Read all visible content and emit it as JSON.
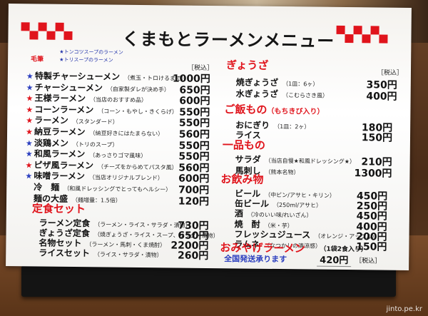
{
  "menu": {
    "title": "くまもとラーメンメニュー",
    "legend": [
      "★トンコツスープのラーメン",
      "★トリスープのラーメン"
    ],
    "stamp": "毛筆",
    "tax_label": "［税込］",
    "ramen": [
      {
        "mark": "blue",
        "name": "特製チャーシューメン",
        "note": "（煮玉・トロけるまで）",
        "price": "1000円"
      },
      {
        "mark": "blue",
        "name": "チャーシューメン",
        "note": "（自家製ダレが決め手）",
        "price": "650円"
      },
      {
        "mark": "red",
        "name": "王様ラーメン",
        "note": "（当店のおすすめ品）",
        "price": "600円"
      },
      {
        "mark": "red",
        "name": "コーンラーメン",
        "note": "（コーン・もやし・きくらげ）",
        "price": "550円"
      },
      {
        "mark": "red",
        "name": "ラーメン",
        "note": "（スタンダード）",
        "price": "550円"
      },
      {
        "mark": "red",
        "name": "納豆ラーメン",
        "note": "（納豆好きにはたまらない）",
        "price": "560円"
      },
      {
        "mark": "blue",
        "name": "淡鶏メン",
        "note": "（トリのスープ）",
        "price": "550円"
      },
      {
        "mark": "blue",
        "name": "和風ラーメン",
        "note": "（あっさりゴマ風味）",
        "price": "550円"
      },
      {
        "mark": "red",
        "name": "ピザ風ラーメン",
        "note": "（チーズをからめてパスタ風）",
        "price": "560円"
      },
      {
        "mark": "blue",
        "name": "味噌ラーメン",
        "note": "（当店オリジナルブレンド）",
        "price": "600円"
      },
      {
        "mark": "",
        "name": "冷　麺",
        "note": "（和風ドレッシングでとってもヘルシー）",
        "price": "700円"
      },
      {
        "mark": "",
        "name": "麺の大盛",
        "note": "（麺増量：1.5倍）",
        "price": "120円"
      }
    ],
    "teishoku_title": "定食セット",
    "teishoku": [
      {
        "name": "ラーメン定食",
        "note": "（ラーメン・ライス・サラダ・漬物）",
        "price": "730円"
      },
      {
        "name": "ぎょうざ定食",
        "note": "（焼ぎょうざ・ライス・スープ、サラダ・漬物）",
        "price": "650円"
      },
      {
        "name": "名物セット",
        "note": "（ラーメン・馬刺・くま焼酎）",
        "price": "2200円"
      },
      {
        "name": "ライスセット",
        "note": "（ライス・サラダ・漬物）",
        "price": "260円"
      }
    ],
    "gyoza_title": "ぎょうざ",
    "gyoza": [
      {
        "name": "焼ぎょうざ",
        "note": "（1皿：6ヶ）",
        "price": "350円"
      },
      {
        "name": "水ぎょうざ",
        "note": "（こむらさき風）",
        "price": "400円"
      }
    ],
    "gohan_title": "ご飯もの",
    "gohan_sub": "（もちきび入り）",
    "gohan": [
      {
        "name": "おにぎり",
        "note": "（1皿：2ヶ）",
        "price": "180円"
      },
      {
        "name": "ライス",
        "note": "",
        "price": "150円"
      }
    ],
    "ippin_title": "一品もの",
    "ippin": [
      {
        "name": "サラダ",
        "note": "（当店自慢★和風ドレッシング★）",
        "price": "210円"
      },
      {
        "name": "馬刺し",
        "note": "（熊本名物）",
        "price": "1300円"
      }
    ],
    "drink_title": "お飲み物",
    "drinks": [
      {
        "name": "ビール",
        "note": "（中ビン/アサヒ・キリン）",
        "price": "450円"
      },
      {
        "name": "缶ビール",
        "note": "（250ml/アサヒ）",
        "price": "250円"
      },
      {
        "name": "酒",
        "note": "（冷のいい味/れいざん）",
        "price": "450円"
      },
      {
        "name": "焼　酎",
        "note": "（米・芋）",
        "price": "400円"
      },
      {
        "name": "フレッシュジュース",
        "note": "（オレンジ・アップル）",
        "price": "200円"
      },
      {
        "name": "ラムネ",
        "note": "（なつかしの清涼感）",
        "price": "150円"
      }
    ],
    "souvenir_title": "おみやげラーメン",
    "souvenir_note": "（1袋2食入り）",
    "souvenir_ship": "全国発送承ります",
    "souvenir_price": "420円",
    "souvenir_tax": "［税込］"
  },
  "watermark": "jinto.pe.kr",
  "colors": {
    "accent_red": "#e0141c",
    "accent_blue": "#2c3fbf"
  }
}
